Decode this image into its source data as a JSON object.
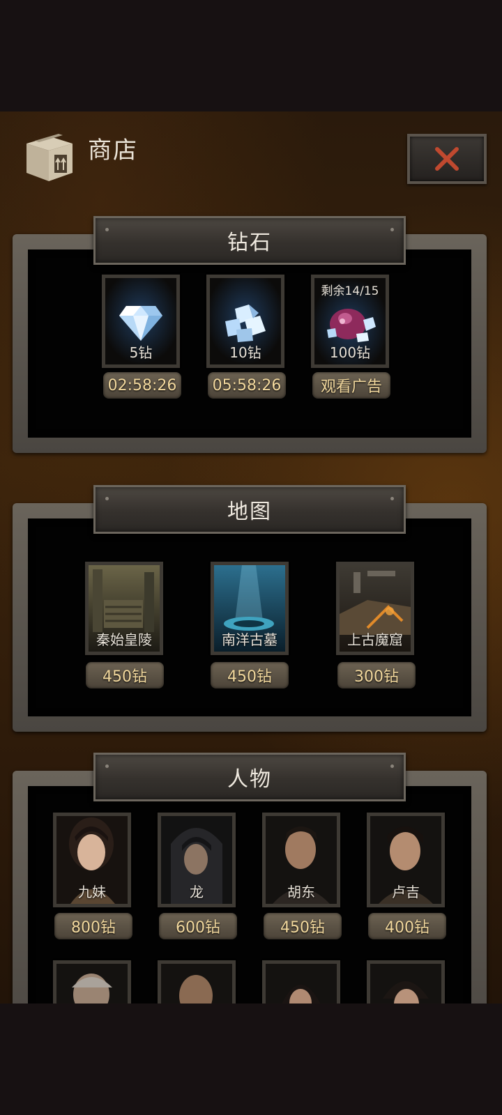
{
  "header": {
    "title": "商店",
    "icon": "box-icon",
    "close_icon": "close-icon"
  },
  "sections": {
    "diamonds": {
      "title": "钻石",
      "items": [
        {
          "label": "5钻",
          "action": "02:58:26",
          "icon": "diamond-icon"
        },
        {
          "label": "10钻",
          "action": "05:58:26",
          "icon": "diamond-pile-icon"
        },
        {
          "label": "100钻",
          "top_label": "剩余14/15",
          "action": "观看广告",
          "icon": "diamond-bag-icon"
        }
      ]
    },
    "maps": {
      "title": "地图",
      "items": [
        {
          "label": "秦始皇陵",
          "price": "450钻"
        },
        {
          "label": "南洋古墓",
          "price": "450钻"
        },
        {
          "label": "上古魔窟",
          "price": "300钻"
        }
      ]
    },
    "characters": {
      "title": "人物",
      "items": [
        {
          "label": "九妹",
          "price": "800钻"
        },
        {
          "label": "龙",
          "price": "600钻"
        },
        {
          "label": "胡东",
          "price": "450钻"
        },
        {
          "label": "卢吉",
          "price": "400钻"
        }
      ]
    }
  },
  "colors": {
    "price_text": "#f3d99e",
    "close_x": "#c0492f",
    "panel_bg": "#020202"
  }
}
